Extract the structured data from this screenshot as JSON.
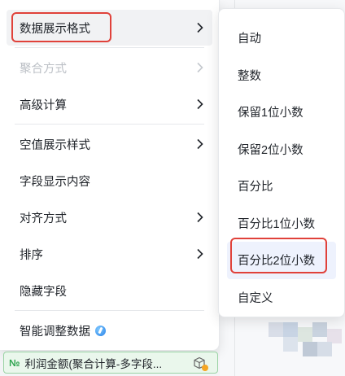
{
  "main_menu": {
    "items": [
      {
        "label": "数据展示格式",
        "has_submenu": true,
        "disabled": false,
        "hover": true
      },
      {
        "label": "聚合方式",
        "has_submenu": true,
        "disabled": true
      },
      {
        "label": "高级计算",
        "has_submenu": true,
        "disabled": false
      },
      {
        "label": "空值展示样式",
        "has_submenu": true,
        "disabled": false
      },
      {
        "label": "字段显示内容",
        "has_submenu": false,
        "disabled": false
      },
      {
        "label": "对齐方式",
        "has_submenu": true,
        "disabled": false
      },
      {
        "label": "排序",
        "has_submenu": true,
        "disabled": false
      },
      {
        "label": "隐藏字段",
        "has_submenu": false,
        "disabled": false
      },
      {
        "label": "智能调整数据",
        "has_submenu": false,
        "disabled": false,
        "icon": "info-icon"
      }
    ]
  },
  "sub_menu": {
    "items": [
      {
        "label": "自动"
      },
      {
        "label": "整数"
      },
      {
        "label": "保留1位小数"
      },
      {
        "label": "保留2位小数"
      },
      {
        "label": "百分比"
      },
      {
        "label": "百分比1位小数"
      },
      {
        "label": "百分比2位小数",
        "selected": true
      },
      {
        "label": "自定义"
      }
    ]
  },
  "field_chip": {
    "icon_text": "№",
    "label": "利润金额(聚合计算-多字段...",
    "icon": "cube-icon"
  },
  "colors": {
    "highlight_red": "#e0413a",
    "selected_bg": "#eef2fd",
    "chip_bg": "#eaf7ec",
    "chip_border": "#9ad3a4"
  }
}
